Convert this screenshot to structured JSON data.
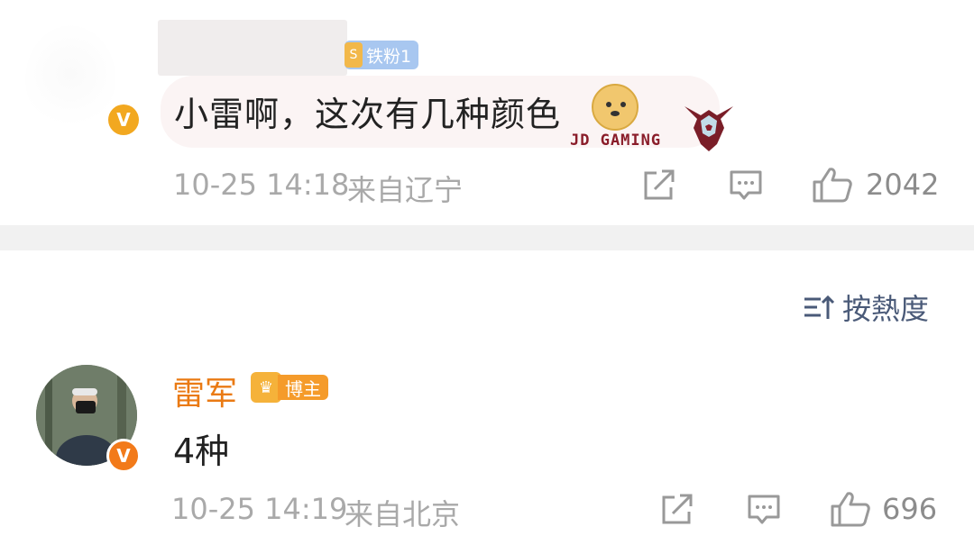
{
  "comments": [
    {
      "username": "",
      "fan_badge": "铁粉1",
      "text": "小雷啊，这次有几种颜色",
      "emoji_name": "doge-emoji",
      "badge_text": "JD GAMING",
      "timestamp": "10-25 14:18",
      "location": "来自辽宁",
      "like_count": "2042"
    },
    {
      "username": "雷军",
      "role_badge": "博主",
      "text": "4种",
      "timestamp": "10-25 14:19",
      "location": "来自北京",
      "like_count": "696"
    }
  ],
  "sort": {
    "label": "按熱度",
    "icon": "sort-icon"
  },
  "icons": {
    "share": "share-icon",
    "comment": "comment-icon",
    "like": "thumbs-up-icon",
    "verify": "verified-v-icon"
  },
  "colors": {
    "verify_gold": "#f2a820",
    "author_name": "#ea7a13",
    "fan_badge": "#a8c7f0",
    "sort_text": "#4a5a78",
    "meta_text": "#a9a9a9"
  }
}
